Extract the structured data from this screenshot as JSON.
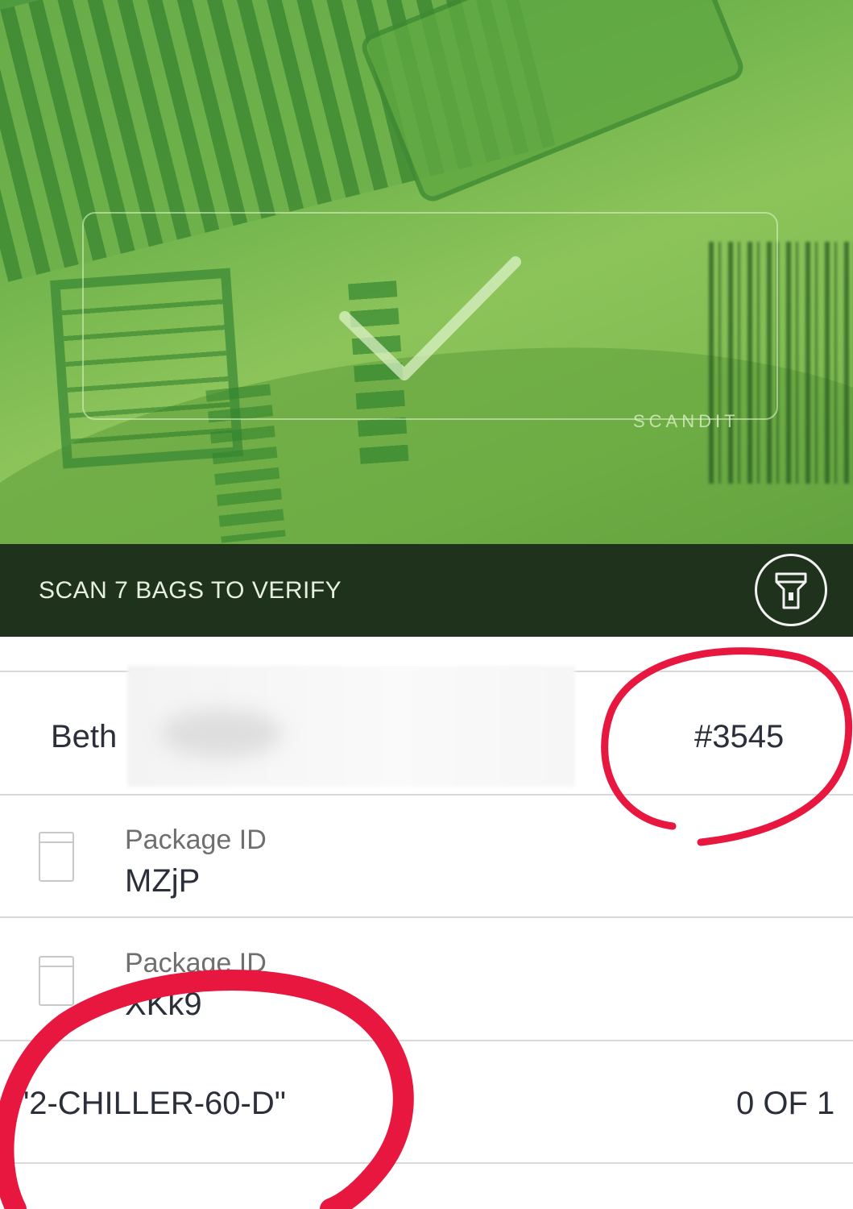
{
  "camera": {
    "brand_label": "SCANDIT",
    "status_text": "SCAN 7 BAGS TO VERIFY",
    "flashlight_icon": "flashlight-icon"
  },
  "customer": {
    "name_visible": "Beth",
    "order_number": "#3545"
  },
  "packages": [
    {
      "label": "Package ID",
      "id": "MZjP"
    },
    {
      "label": "Package ID",
      "id": "XKk9"
    }
  ],
  "zone": {
    "label": "\"2-CHILLER-60-D\"",
    "count": "0 OF 1"
  },
  "colors": {
    "annotation_red": "#e8173f",
    "status_bar": "#1f331c",
    "camera_green": "#7fbb50"
  }
}
